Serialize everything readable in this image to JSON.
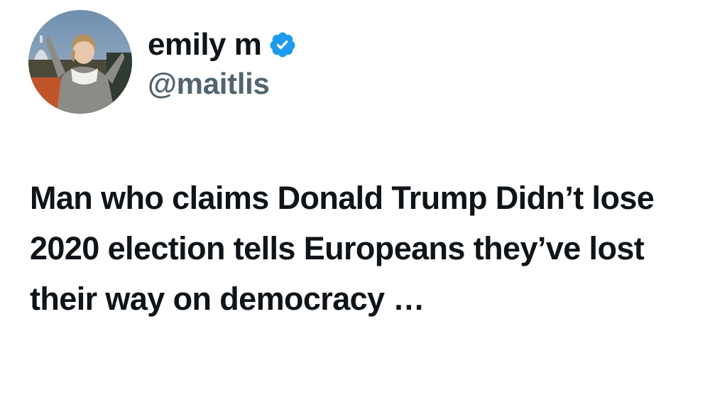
{
  "tweet": {
    "author": {
      "display_name": "emily m",
      "handle": "@maitlis",
      "verified": true,
      "verified_icon": "verified-badge-icon",
      "verified_color": "#1d9bf0"
    },
    "text": "Man who claims Donald Trump Didn’t lose 2020 election tells Europeans they’ve lost their way on democracy …"
  }
}
